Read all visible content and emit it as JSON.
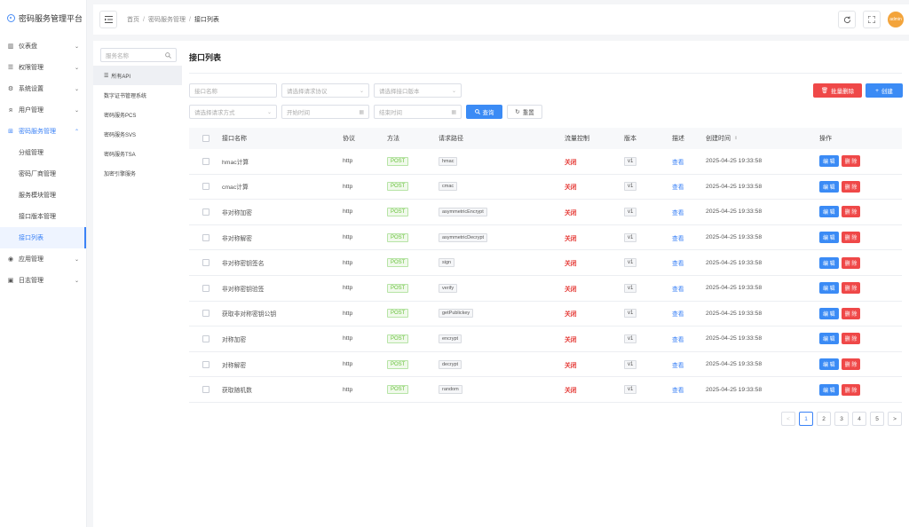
{
  "app": {
    "title": "密码服务管理平台"
  },
  "sidebar": {
    "items": [
      {
        "label": "仪表盘",
        "icon": "chart-icon"
      },
      {
        "label": "权限管理",
        "icon": "list-icon"
      },
      {
        "label": "系统设置",
        "icon": "gear-icon"
      },
      {
        "label": "用户管理",
        "icon": "user-icon"
      },
      {
        "label": "密码服务管理",
        "icon": "grid-icon"
      }
    ],
    "sub_items": [
      {
        "label": "分组管理"
      },
      {
        "label": "密码厂商管理"
      },
      {
        "label": "服务模块管理"
      },
      {
        "label": "接口版本管理"
      },
      {
        "label": "接口列表"
      }
    ],
    "bottom_items": [
      {
        "label": "应用管理",
        "icon": "eye-icon"
      },
      {
        "label": "日志管理",
        "icon": "calendar-icon"
      }
    ]
  },
  "header": {
    "breadcrumb": [
      "首页",
      "密码服务管理",
      "接口列表"
    ],
    "avatar_text": "admin"
  },
  "services": {
    "search_placeholder": "服务名称",
    "items": [
      {
        "label": "所有API"
      },
      {
        "label": "数字证书管理系统"
      },
      {
        "label": "密码服务PCS"
      },
      {
        "label": "密码服务SVS"
      },
      {
        "label": "密码服务TSA"
      },
      {
        "label": "加密引擎服务"
      }
    ]
  },
  "main": {
    "title": "接口列表",
    "filters": {
      "name_placeholder": "接口名称",
      "protocol_placeholder": "请选择请求协议",
      "version_placeholder": "请选择接口版本",
      "method_placeholder": "请选择请求方式",
      "start_placeholder": "开始时间",
      "end_placeholder": "结束时间",
      "query_label": "查询",
      "reset_label": "重置"
    },
    "actions": {
      "batch_delete_label": "批量删除",
      "create_label": "创建"
    },
    "table": {
      "headers": {
        "name": "接口名称",
        "protocol": "协议",
        "method": "方法",
        "path": "请求路径",
        "flow": "流量控制",
        "version": "版本",
        "desc": "描述",
        "created": "创建时间",
        "ops": "操作"
      },
      "rows": [
        {
          "name": "hmac计算",
          "protocol": "http",
          "method": "POST",
          "path": "hmac",
          "flow": "关闭",
          "version": "v1",
          "desc": "查看",
          "created": "2025-04-25 19:33:58",
          "edit": "编 辑",
          "del": "删 除"
        },
        {
          "name": "cmac计算",
          "protocol": "http",
          "method": "POST",
          "path": "cmac",
          "flow": "关闭",
          "version": "v1",
          "desc": "查看",
          "created": "2025-04-25 19:33:58",
          "edit": "编 辑",
          "del": "删 除"
        },
        {
          "name": "非对称加密",
          "protocol": "http",
          "method": "POST",
          "path": "asymmetricEncrypt",
          "flow": "关闭",
          "version": "v1",
          "desc": "查看",
          "created": "2025-04-25 19:33:58",
          "edit": "编 辑",
          "del": "删 除"
        },
        {
          "name": "非对称解密",
          "protocol": "http",
          "method": "POST",
          "path": "asymmetricDecrypt",
          "flow": "关闭",
          "version": "v1",
          "desc": "查看",
          "created": "2025-04-25 19:33:58",
          "edit": "编 辑",
          "del": "删 除"
        },
        {
          "name": "非对称密钥签名",
          "protocol": "http",
          "method": "POST",
          "path": "sign",
          "flow": "关闭",
          "version": "v1",
          "desc": "查看",
          "created": "2025-04-25 19:33:58",
          "edit": "编 辑",
          "del": "删 除"
        },
        {
          "name": "非对称密钥验签",
          "protocol": "http",
          "method": "POST",
          "path": "verify",
          "flow": "关闭",
          "version": "v1",
          "desc": "查看",
          "created": "2025-04-25 19:33:58",
          "edit": "编 辑",
          "del": "删 除"
        },
        {
          "name": "获取非对称密钥公钥",
          "protocol": "http",
          "method": "POST",
          "path": "getPublickey",
          "flow": "关闭",
          "version": "v1",
          "desc": "查看",
          "created": "2025-04-25 19:33:58",
          "edit": "编 辑",
          "del": "删 除"
        },
        {
          "name": "对称加密",
          "protocol": "http",
          "method": "POST",
          "path": "encrypt",
          "flow": "关闭",
          "version": "v1",
          "desc": "查看",
          "created": "2025-04-25 19:33:58",
          "edit": "编 辑",
          "del": "删 除"
        },
        {
          "name": "对称解密",
          "protocol": "http",
          "method": "POST",
          "path": "decrypt",
          "flow": "关闭",
          "version": "v1",
          "desc": "查看",
          "created": "2025-04-25 19:33:58",
          "edit": "编 辑",
          "del": "删 除"
        },
        {
          "name": "获取随机数",
          "protocol": "http",
          "method": "POST",
          "path": "random",
          "flow": "关闭",
          "version": "v1",
          "desc": "查看",
          "created": "2025-04-25 19:33:58",
          "edit": "编 辑",
          "del": "删 除"
        }
      ]
    },
    "pagination": {
      "prev": "<",
      "next": ">",
      "pages": [
        "1",
        "2",
        "3",
        "4",
        "5"
      ],
      "current": "1"
    }
  },
  "colors": {
    "accent": "#3b8bf5",
    "danger": "#ef4848",
    "success": "#67c23a"
  }
}
